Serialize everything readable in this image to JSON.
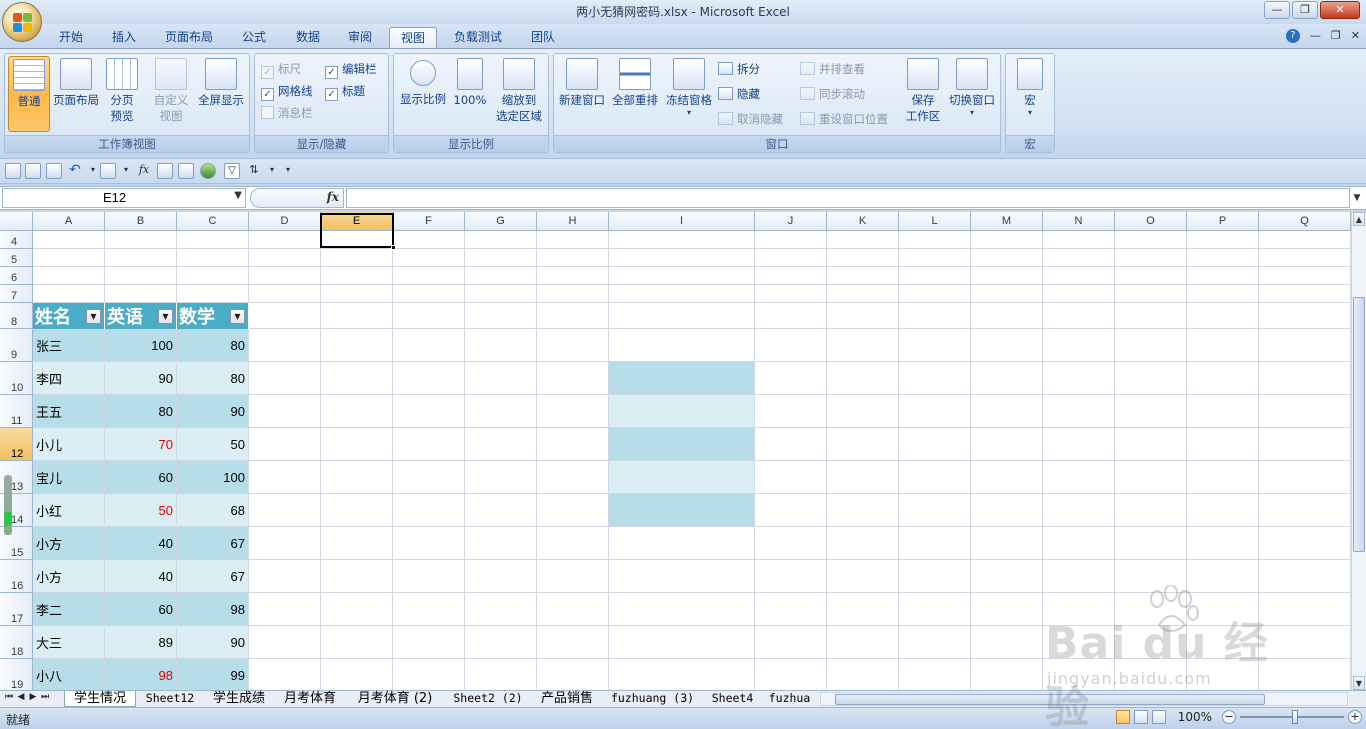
{
  "window": {
    "title": "两小无猜网密码.xlsx - Microsoft Excel"
  },
  "tabs": [
    "开始",
    "插入",
    "页面布局",
    "公式",
    "数据",
    "审阅",
    "视图",
    "负载测试",
    "团队"
  ],
  "active_tab": "视图",
  "ribbon": {
    "workbook_views": {
      "label": "工作簿视图",
      "normal": "普通",
      "page_layout": "页面布局",
      "page_break": [
        "分页",
        "预览"
      ],
      "custom": [
        "自定义",
        "视图"
      ],
      "fullscreen": "全屏显示"
    },
    "show_hide": {
      "label": "显示/隐藏",
      "ruler": "标尺",
      "gridlines": "网格线",
      "message_bar": "消息栏",
      "formula_bar": "编辑栏",
      "headings": "标题"
    },
    "zoom": {
      "label": "显示比例",
      "zoom": "显示比例",
      "hundred": "100%",
      "zoom_selection": [
        "缩放到",
        "选定区域"
      ]
    },
    "window": {
      "label": "窗口",
      "new_window": "新建窗口",
      "arrange_all": "全部重排",
      "freeze": "冻结窗格",
      "split": "拆分",
      "hide": "隐藏",
      "unhide": "取消隐藏",
      "side_by_side": "并排查看",
      "sync_scroll": "同步滚动",
      "reset_position": "重设窗口位置",
      "save_workspace": [
        "保存",
        "工作区"
      ],
      "switch_windows": "切换窗口"
    },
    "macros": {
      "label": "宏",
      "macros": "宏"
    }
  },
  "formula_bar": {
    "name_box": "E12",
    "fx": "fx",
    "value": ""
  },
  "columns": [
    "A",
    "B",
    "C",
    "D",
    "E",
    "F",
    "G",
    "H",
    "I",
    "J",
    "K",
    "L",
    "M",
    "N",
    "O",
    "P",
    "Q"
  ],
  "selected_column": "E",
  "rows": [
    "4",
    "5",
    "6",
    "7",
    "8",
    "9",
    "10",
    "11",
    "12",
    "13",
    "14",
    "15",
    "16",
    "17",
    "18",
    "19"
  ],
  "selected_row": "12",
  "table": {
    "headers": [
      "姓名",
      "英语",
      "数学"
    ],
    "rows": [
      {
        "name": "张三",
        "english": "100",
        "math": "80",
        "english_red": false
      },
      {
        "name": "李四",
        "english": "90",
        "math": "80",
        "english_red": false
      },
      {
        "name": "王五",
        "english": "80",
        "math": "90",
        "english_red": false
      },
      {
        "name": "小儿",
        "english": "70",
        "math": "50",
        "english_red": true
      },
      {
        "name": "宝儿",
        "english": "60",
        "math": "100",
        "english_red": false
      },
      {
        "name": "小红",
        "english": "50",
        "math": "68",
        "english_red": true
      },
      {
        "name": "小方",
        "english": "40",
        "math": "67",
        "english_red": false
      },
      {
        "name": "小方",
        "english": "40",
        "math": "67",
        "english_red": false
      },
      {
        "name": "李二",
        "english": "60",
        "math": "98",
        "english_red": false
      },
      {
        "name": "大三",
        "english": "89",
        "math": "90",
        "english_red": false
      },
      {
        "name": "小八",
        "english": "98",
        "math": "99",
        "english_red": true
      }
    ]
  },
  "colors": {
    "table_header": "#4bacc6",
    "band_dark": "#b7dde8",
    "band_light": "#dbeef3",
    "red_value": "#e00000",
    "ribbon_active": "#ffb748"
  },
  "sheet_tabs": [
    "学生情况",
    "Sheet12",
    "学生成绩",
    "月考体育",
    "月考体育 (2)",
    "Sheet2 (2)",
    "产品销售",
    "fuzhuang (3)",
    "Sheet4",
    "fuzhua"
  ],
  "active_sheet": "学生情况",
  "status": {
    "ready": "就绪",
    "zoom": "100%"
  },
  "watermark": {
    "brand": "Bai du 经验",
    "url": "jingyan.baidu.com"
  }
}
